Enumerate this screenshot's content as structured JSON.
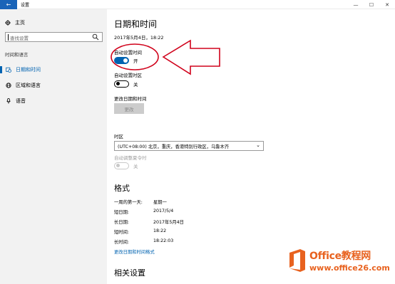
{
  "window": {
    "title": "设置",
    "minimize_glyph": "—",
    "maximize_glyph": "☐",
    "close_glyph": "✕",
    "back_glyph": "←"
  },
  "sidebar": {
    "home_label": "主页",
    "search_placeholder": "查找设置",
    "section_label": "时间和语言",
    "items": [
      {
        "label": "日期和时间",
        "icon": "calendar-clock-icon",
        "active": true
      },
      {
        "label": "区域和语言",
        "icon": "globe-icon",
        "active": false
      },
      {
        "label": "语音",
        "icon": "microphone-icon",
        "active": false
      }
    ]
  },
  "main": {
    "title": "日期和时间",
    "current_datetime": "2017年5月4日，18:22",
    "auto_time": {
      "label": "自动设置时间",
      "state_text": "开",
      "on": true
    },
    "auto_timezone": {
      "label": "自动设置时区",
      "state_text": "关",
      "on": false
    },
    "change_datetime": {
      "label": "更改日期和时间",
      "button": "更改"
    },
    "timezone": {
      "label": "时区",
      "value": "(UTC+08:00) 北京，重庆，香港特别行政区，乌鲁木齐"
    },
    "dst": {
      "label": "自动调整夏令时",
      "state_text": "关",
      "disabled": true
    },
    "format": {
      "title": "格式",
      "rows": [
        {
          "key": "一周的第一天:",
          "value": "星期一"
        },
        {
          "key": "短日期:",
          "value": "2017/5/4"
        },
        {
          "key": "长日期:",
          "value": "2017年5月4日"
        },
        {
          "key": "短时间:",
          "value": "18:22"
        },
        {
          "key": "长时间:",
          "value": "18:22:03"
        }
      ],
      "link": "更改日期和时间格式"
    },
    "related_title": "相关设置"
  },
  "watermark": {
    "brand": "Office教程网",
    "url": "www.office26.com"
  },
  "colors": {
    "accent": "#0063b1",
    "annotation": "#d0021b",
    "watermark": "#e8621f"
  }
}
